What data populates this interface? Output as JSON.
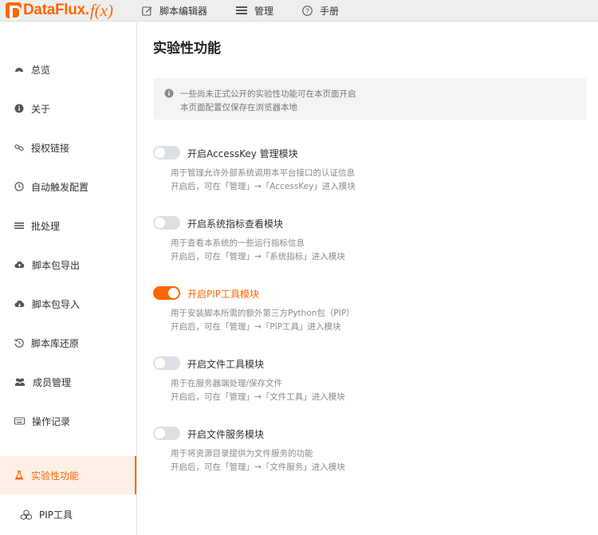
{
  "header": {
    "logo_text": "DataFlux.",
    "logo_fx": "f(x)",
    "nav": [
      {
        "label": "脚本编辑器",
        "icon": "edit-icon"
      },
      {
        "label": "管理",
        "icon": "manage-icon"
      },
      {
        "label": "手册",
        "icon": "help-icon"
      }
    ]
  },
  "sidebar": {
    "items": [
      {
        "label": "总览",
        "icon": "overview-icon"
      },
      {
        "label": "关于",
        "icon": "info-icon"
      },
      {
        "label": "授权链接",
        "icon": "link-icon"
      },
      {
        "label": "自动触发配置",
        "icon": "clock-icon"
      },
      {
        "label": "批处理",
        "icon": "list-icon"
      },
      {
        "label": "脚本包导出",
        "icon": "cloud-upload-icon"
      },
      {
        "label": "脚本包导入",
        "icon": "cloud-download-icon"
      },
      {
        "label": "脚本库还原",
        "icon": "history-icon"
      },
      {
        "label": "成员管理",
        "icon": "users-icon"
      },
      {
        "label": "操作记录",
        "icon": "keyboard-icon"
      },
      {
        "label": "实验性功能",
        "icon": "flask-icon",
        "active": true
      },
      {
        "label": "PIP工具",
        "icon": "cubes-icon",
        "sub": true
      }
    ]
  },
  "main": {
    "title": "实验性功能",
    "notice": {
      "line1": "一些尚未正式公开的实验性功能可在本页面开启",
      "line2": "本页面配置仅保存在浏览器本地"
    },
    "modules": [
      {
        "title": "开启AccessKey 管理模块",
        "enabled": false,
        "desc1": "用于管理允许外部系统调用本平台接口的认证信息",
        "desc2": "开启后，可在「管理」→「AccessKey」进入模块"
      },
      {
        "title": "开启系统指标查看模块",
        "enabled": false,
        "desc1": "用于查看本系统的一些运行指标信息",
        "desc2": "开启后，可在「管理」→「系统指标」进入模块"
      },
      {
        "title": "开启PIP工具模块",
        "enabled": true,
        "desc1": "用于安装脚本所需的额外第三方Python包（PIP）",
        "desc2": "开启后，可在「管理」→「PIP工具」进入模块"
      },
      {
        "title": "开启文件工具模块",
        "enabled": false,
        "desc1": "用于在服务器端处理/保存文件",
        "desc2": "开启后，可在「管理」→「文件工具」进入模块"
      },
      {
        "title": "开启文件服务模块",
        "enabled": false,
        "desc1": "用于将资源目录提供为文件服务的功能",
        "desc2": "开启后，可在「管理」→「文件服务」进入模块"
      }
    ]
  },
  "colors": {
    "accent": "#ff6600",
    "toggle_off": "#dcdfe6",
    "active_bg": "#fef0e6"
  }
}
